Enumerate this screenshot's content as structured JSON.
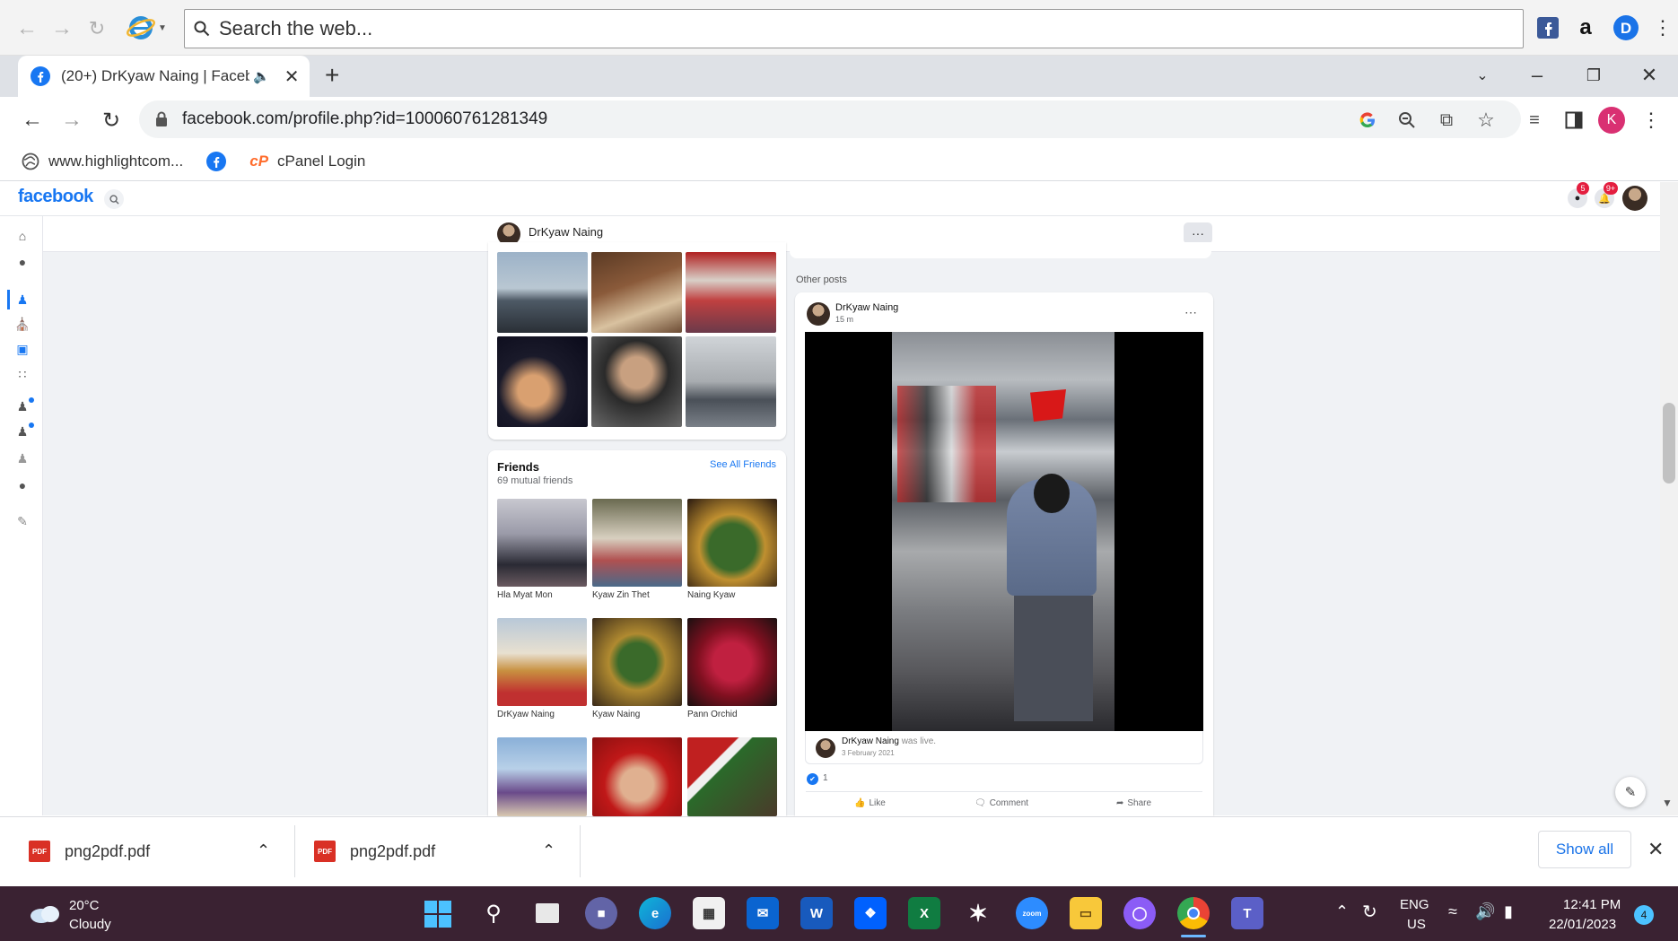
{
  "ie_toolbar": {
    "search_placeholder": "Search the web..."
  },
  "chrome": {
    "tab_title": "(20+) DrKyaw Naing | Facebo",
    "new_tab_symbol": "+",
    "url": "facebook.com/profile.php?id=100060761281349",
    "profile_initial": "K"
  },
  "bookmarks": [
    {
      "label": "www.highlightcom...",
      "icon": "globe-icon"
    },
    {
      "label": "",
      "icon": "facebook-icon"
    },
    {
      "label": "cPanel Login",
      "icon": "cpanel-icon"
    }
  ],
  "facebook": {
    "logo": "facebook",
    "profile_name": "DrKyaw Naing",
    "more_label": "···",
    "notification_badges": [
      "5",
      "9+"
    ],
    "friends": {
      "title": "Friends",
      "subtitle": "69 mutual friends",
      "see_all": "See All Friends",
      "list": [
        {
          "name": "Hla Myat Mon"
        },
        {
          "name": "Kyaw Zin Thet"
        },
        {
          "name": "Naing Kyaw"
        },
        {
          "name": "DrKyaw Naing"
        },
        {
          "name": "Kyaw Naing"
        },
        {
          "name": "Pann Orchid"
        }
      ]
    },
    "post": {
      "section_label": "Other posts",
      "author": "DrKyaw Naing",
      "time": "15 m",
      "shared_author": "DrKyaw Naing",
      "shared_suffix": " was live.",
      "shared_date": "3 February 2021",
      "reactions_count": "1",
      "actions": [
        "Like",
        "Comment",
        "Share"
      ]
    }
  },
  "downloads": {
    "items": [
      {
        "name": "png2pdf.pdf"
      },
      {
        "name": "png2pdf.pdf"
      }
    ],
    "show_all": "Show all"
  },
  "taskbar": {
    "weather_temp": "20°C",
    "weather_desc": "Cloudy",
    "lang": "ENG",
    "region": "US",
    "time": "12:41 PM",
    "date": "22/01/2023",
    "notification_count": "4"
  }
}
